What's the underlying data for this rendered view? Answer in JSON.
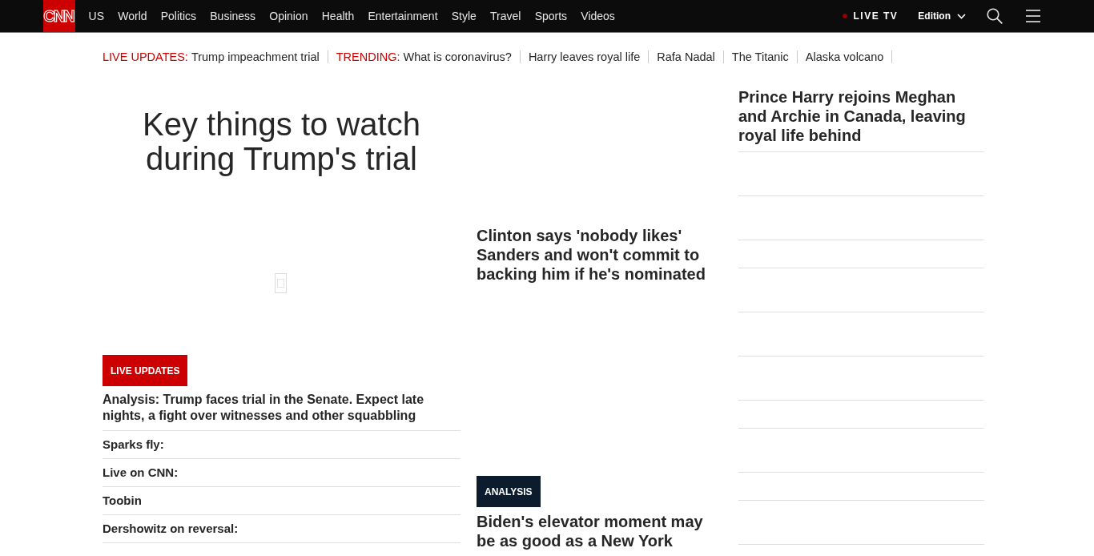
{
  "nav": {
    "logo": "CNN",
    "links": [
      "US",
      "World",
      "Politics",
      "Business",
      "Opinion",
      "Health",
      "Entertainment",
      "Style",
      "Travel",
      "Sports",
      "Videos"
    ],
    "live_tv": "LIVE TV",
    "edition": "Edition"
  },
  "trending_bar": {
    "items": [
      {
        "label": "LIVE UPDATES:",
        "text": "Trump impeachment trial"
      },
      {
        "label": "TRENDING:",
        "text": "What is coronavirus?"
      },
      {
        "text": "Harry leaves royal life"
      },
      {
        "text": "Rafa Nadal"
      },
      {
        "text": "The Titanic"
      },
      {
        "text": "Alaska volcano"
      }
    ]
  },
  "lead_story": {
    "headline": "Key things to watch during Trump's trial",
    "badge": "LIVE UPDATES",
    "headline_link": "Analysis: Trump faces trial in the Senate. Expect late nights, a fight over witnesses and other squabbling",
    "links": [
      "Sparks fly:",
      "Live on CNN:",
      "Toobin",
      "Dershowitz on reversal:"
    ]
  },
  "middle_column": {
    "stories": [
      {
        "headline": "Clinton says 'nobody likes' Sanders and won't commit to backing him if he's nominated"
      },
      {
        "badge": "ANALYSIS",
        "headline": "Biden's elevator moment may be as good as a New York"
      }
    ]
  },
  "right_column": {
    "headline": "Prince Harry rejoins Meghan and Archie in Canada, leaving royal life behind"
  }
}
